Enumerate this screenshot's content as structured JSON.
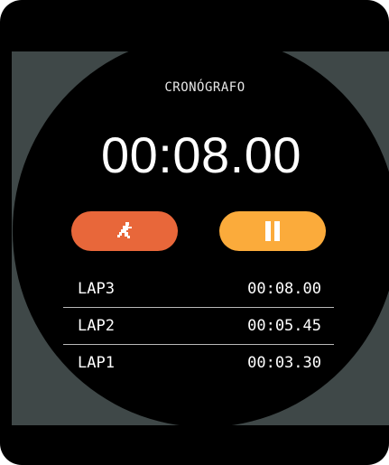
{
  "app": {
    "title": "CRONÓGRAFO",
    "elapsed": "00:08.00"
  },
  "controls": {
    "reset_icon": "runner-icon",
    "pause_icon": "pause-icon",
    "reset_color": "#e8673a",
    "pause_color": "#fbab3b"
  },
  "laps": [
    {
      "label": "LAP3",
      "time": "00:08.00"
    },
    {
      "label": "LAP2",
      "time": "00:05.45"
    },
    {
      "label": "LAP1",
      "time": "00:03.30"
    }
  ],
  "colors": {
    "background": "#000000",
    "screen": "#3f4848",
    "text": "#ffffff"
  }
}
